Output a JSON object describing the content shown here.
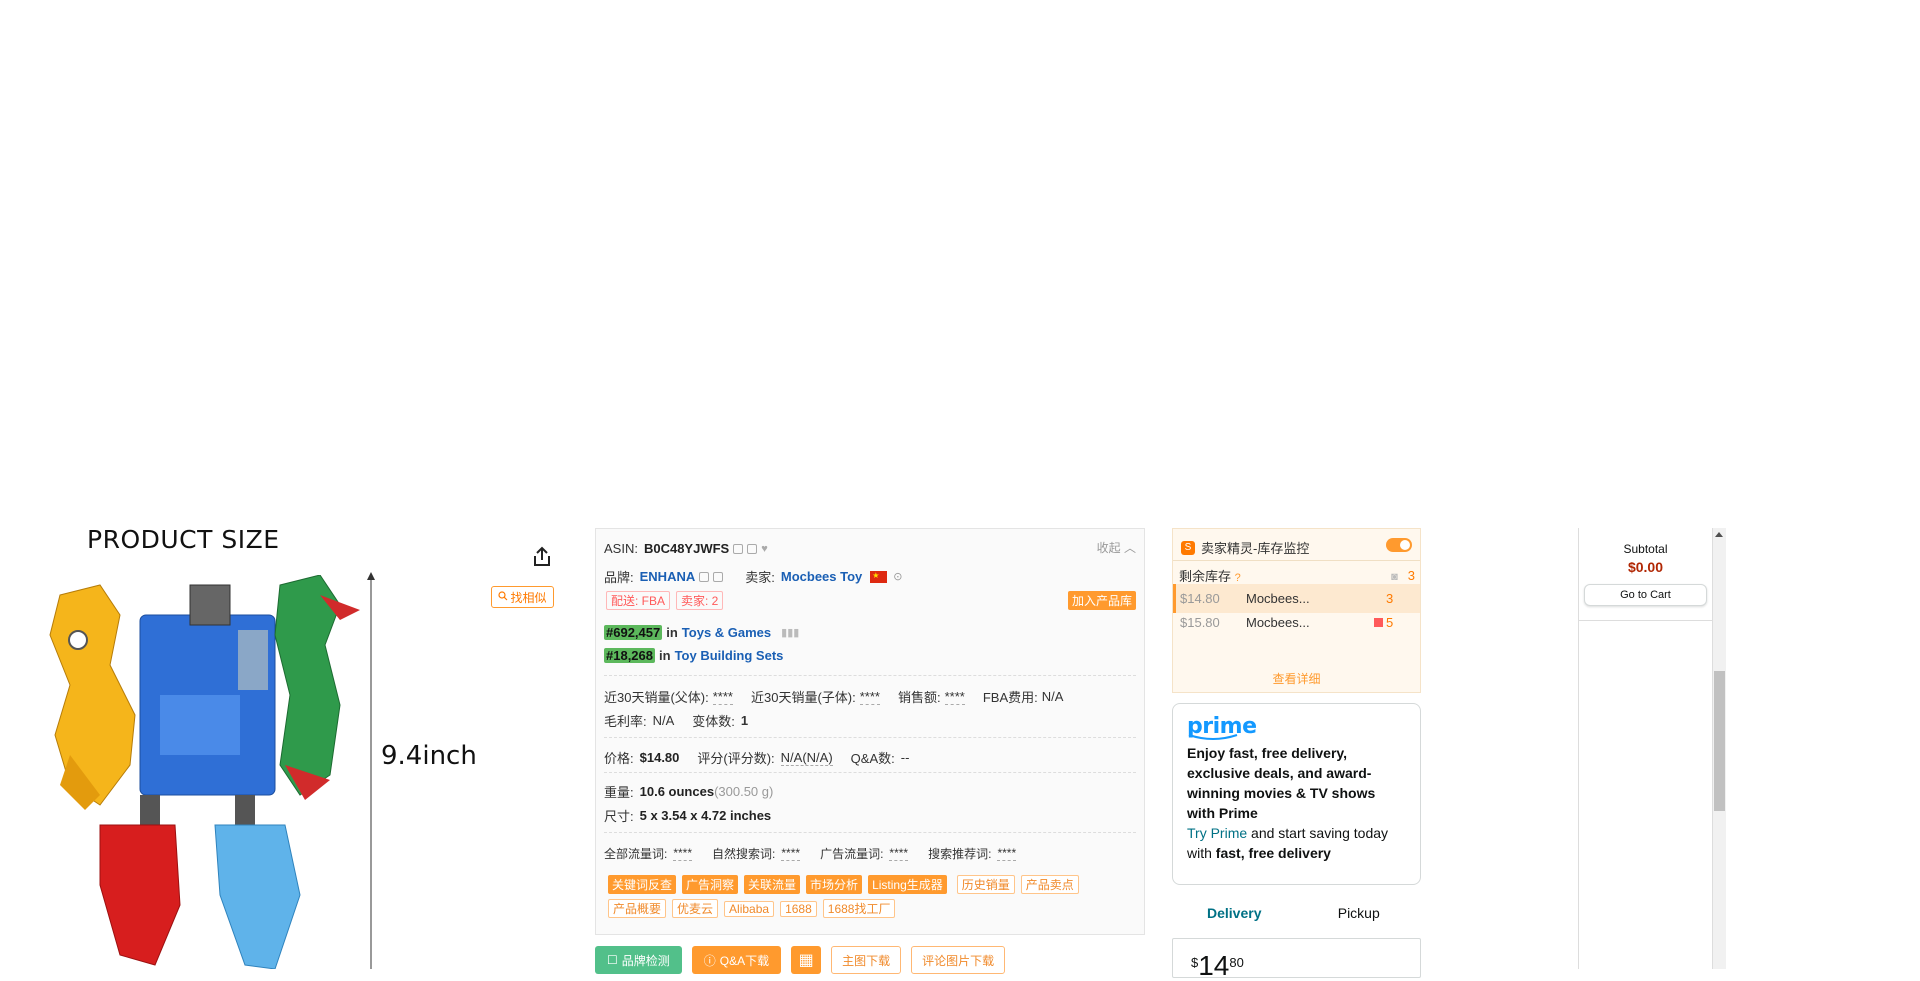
{
  "product_image": {
    "title": "PRODUCT SIZE",
    "size_label": "9.4inch"
  },
  "actions": {
    "find_similar": "找相似"
  },
  "seller_panel": {
    "asin_label": "ASIN:",
    "asin": "B0C48YJWFS",
    "collapse": "收起",
    "brand_label": "品牌:",
    "brand": "ENHANA",
    "seller_label": "卖家:",
    "seller": "Mocbees Toy",
    "delivery_tag": "配送: FBA",
    "sellers_tag": "卖家: 2",
    "add_library": "加入产品库",
    "ranks": [
      {
        "rank": "#692,457",
        "in": "in",
        "category": "Toys & Games"
      },
      {
        "rank": "#18,268",
        "in": "in",
        "category": "Toy Building Sets"
      }
    ],
    "sales": {
      "parent_30d_label": "近30天销量(父体):",
      "parent_30d": "****",
      "child_30d_label": "近30天销量(子体):",
      "child_30d": "****",
      "revenue_label": "销售额:",
      "revenue": "****",
      "fba_fee_label": "FBA费用:",
      "fba_fee": "N/A",
      "margin_label": "毛利率:",
      "margin": "N/A",
      "variants_label": "变体数:",
      "variants": "1"
    },
    "price_row": {
      "price_label": "价格:",
      "price": "$14.80",
      "rating_label": "评分(评分数):",
      "rating": "N/A(N/A)",
      "qa_label": "Q&A数:",
      "qa": "--"
    },
    "specs": {
      "weight_label": "重量:",
      "weight": "10.6 ounces",
      "weight_g": "(300.50 g)",
      "dims_label": "尺寸:",
      "dims": "5 x 3.54 x 4.72 inches"
    },
    "traffic": {
      "all_label": "全部流量词:",
      "all": "****",
      "organic_label": "自然搜索词:",
      "organic": "****",
      "ads_label": "广告流量词:",
      "ads": "****",
      "rec_label": "搜索推荐词:",
      "rec": "****"
    },
    "tags_fill": [
      "关键词反查",
      "广告洞察",
      "关联流量",
      "市场分析",
      "Listing生成器"
    ],
    "tags_outline_row1": [
      "历史销量",
      "产品卖点"
    ],
    "tags_outline_row2": [
      "产品概要",
      "优麦云",
      "Alibaba",
      "1688",
      "1688找工厂"
    ]
  },
  "bottom_buttons": {
    "brand_check": "品牌检测",
    "qa_download": "Q&A下载",
    "main_img_download": "主图下载",
    "review_img_download": "评论图片下载"
  },
  "inventory": {
    "title": "卖家精灵-库存监控",
    "remaining_label": "剩余库存",
    "remaining": "3",
    "rows": [
      {
        "price": "$14.80",
        "seller": "Mocbees...",
        "qty": "3"
      },
      {
        "price": "$15.80",
        "seller": "Mocbees...",
        "qty": "5"
      }
    ],
    "details": "查看详细"
  },
  "prime": {
    "logo": "prime",
    "headline": "Enjoy fast, free delivery, exclusive deals, and award-winning movies & TV shows with Prime",
    "try": "Try Prime",
    "sub_mid": " and start saving today with ",
    "sub_bold": "fast, free delivery"
  },
  "buy_tabs": {
    "delivery": "Delivery",
    "pickup": "Pickup"
  },
  "buy_box": {
    "currency": "$",
    "price_int": "14",
    "price_frac": "80"
  },
  "cart": {
    "subtotal_label": "Subtotal",
    "subtotal": "$0.00",
    "go_to_cart": "Go to Cart"
  }
}
